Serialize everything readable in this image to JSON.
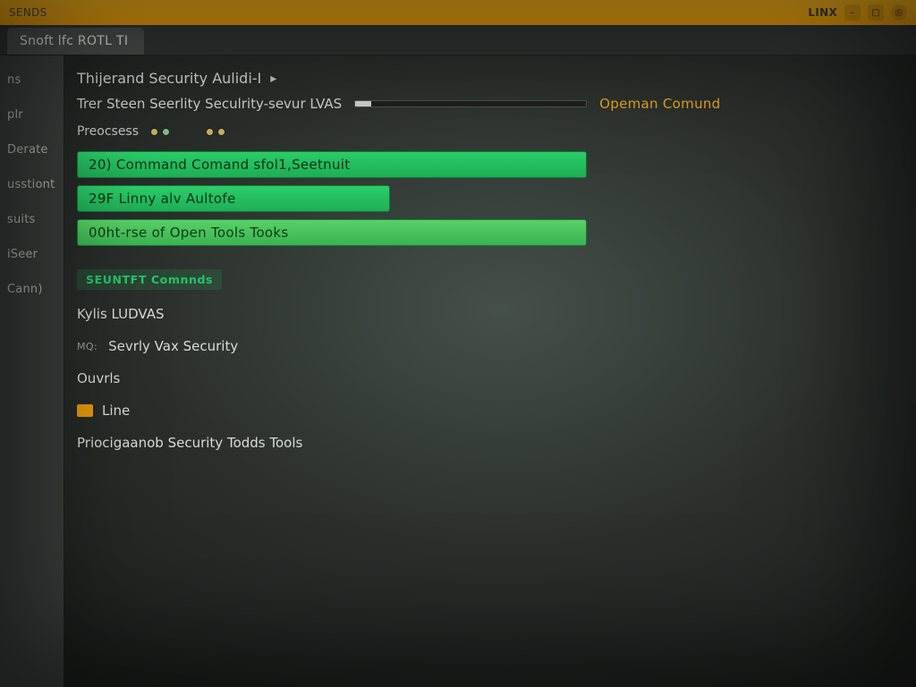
{
  "titlebar": {
    "left_hint": "SENDS",
    "os_label": "LINX",
    "buttons": {
      "min": "–",
      "max": "▢",
      "close": "◎"
    }
  },
  "tab": {
    "title": "Snoft lfc ROTL TI"
  },
  "sidebar": {
    "items": [
      {
        "label": "ns"
      },
      {
        "label": "plr"
      },
      {
        "label": "Derate"
      },
      {
        "label": "usstiont"
      },
      {
        "label": "suits"
      },
      {
        "label": "iSeer"
      },
      {
        "label": "Cann)"
      }
    ]
  },
  "header": {
    "row1": "Thijerand Security Aulidi-I",
    "row2_sub": "Trer Steen Seerlity Seculrity-sevur LVAS",
    "row2_status": "Opeman Comund",
    "processes_label": "Preocsess"
  },
  "bars": [
    {
      "label": "20) Command Comand sfol1,Seetnuit"
    },
    {
      "label": "29F Linny alv Aultofe"
    },
    {
      "label": "00ht-rse of Open Tools Tooks"
    }
  ],
  "section_commands_label": "SEUNTFT Comnnds",
  "list": [
    {
      "prefix": "",
      "label": "Kylis LUDVAS"
    },
    {
      "prefix": "MQ:",
      "label": "Sevrly Vax Security"
    },
    {
      "prefix": "",
      "label": "Ouvrls"
    },
    {
      "prefix": "chip",
      "label": "Line"
    },
    {
      "prefix": "",
      "label": "Priocigaanob Security Todds Tools"
    }
  ]
}
